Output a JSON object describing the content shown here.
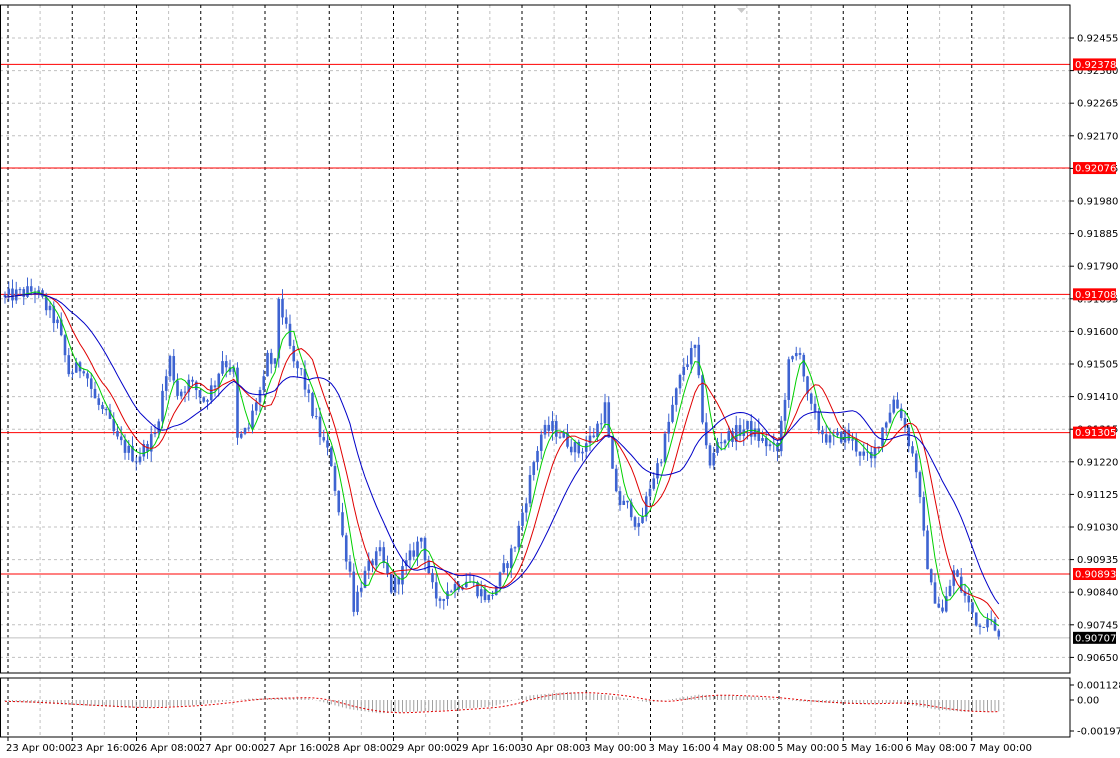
{
  "colors": {
    "background": "#ffffff",
    "grid": "#c0c0c0",
    "grid_vertical": "#000000",
    "candles": "#3d63d1",
    "level_lines": "#ff0000",
    "ma_fast": "#00d000",
    "ma_mid": "#e00000",
    "ma_slow": "#0000c8",
    "osc_histogram": "#a0a0a0",
    "osc_signal": "#e00000",
    "current_price_tag": "#000000"
  },
  "chart_data": [
    {
      "type": "candlestick",
      "title": "",
      "grid": true,
      "ylim": [
        0.9059,
        0.9252
      ],
      "y_ticks": [
        "0.92455",
        "0.92360",
        "0.92265",
        "0.92170",
        "0.92075",
        "0.91980",
        "0.91885",
        "0.91790",
        "0.91695",
        "0.91600",
        "0.91505",
        "0.91410",
        "0.91315",
        "0.91220",
        "0.91125",
        "0.91030",
        "0.90935",
        "0.90840",
        "0.90745",
        "0.90650"
      ],
      "x_tick_labels": [
        "23 Apr 00:00",
        "23 Apr 16:00",
        "26 Apr 08:00",
        "27 Apr 00:00",
        "27 Apr 16:00",
        "28 Apr 08:00",
        "29 Apr 00:00",
        "29 Apr 16:00",
        "30 Apr 08:00",
        "3 May 00:00",
        "3 May 16:00",
        "4 May 08:00",
        "5 May 00:00",
        "5 May 16:00",
        "6 May 08:00",
        "7 May 00:00"
      ],
      "levels": [
        {
          "label": "0.92378",
          "value": 0.92378
        },
        {
          "label": "0.92076",
          "value": 0.92076
        },
        {
          "label": "0.91708",
          "value": 0.91708
        },
        {
          "label": "0.91305",
          "value": 0.91305
        },
        {
          "label": "0.90893",
          "value": 0.90893
        }
      ],
      "current_price": {
        "label": "0.90707",
        "value": 0.90707
      },
      "price_path": [
        [
          0,
          0.917
        ],
        [
          8,
          0.9172
        ],
        [
          14,
          0.9162
        ],
        [
          17,
          0.9148
        ],
        [
          21,
          0.915
        ],
        [
          24,
          0.914
        ],
        [
          27,
          0.9135
        ],
        [
          30,
          0.9128
        ],
        [
          35,
          0.9123
        ],
        [
          40,
          0.913
        ],
        [
          42,
          0.9142
        ],
        [
          44,
          0.9152
        ],
        [
          46,
          0.9142
        ],
        [
          49,
          0.9145
        ],
        [
          51,
          0.9143
        ],
        [
          53,
          0.914
        ],
        [
          56,
          0.9145
        ],
        [
          58,
          0.9152
        ],
        [
          61,
          0.9148
        ],
        [
          62,
          0.9128
        ],
        [
          65,
          0.9132
        ],
        [
          67,
          0.914
        ],
        [
          69,
          0.9145
        ],
        [
          70,
          0.9152
        ],
        [
          72,
          0.915
        ],
        [
          73,
          0.917
        ],
        [
          75,
          0.916
        ],
        [
          77,
          0.915
        ],
        [
          79,
          0.9148
        ],
        [
          81,
          0.914
        ],
        [
          84,
          0.913
        ],
        [
          87,
          0.9122
        ],
        [
          90,
          0.91
        ],
        [
          92,
          0.909
        ],
        [
          93,
          0.908
        ],
        [
          95,
          0.9087
        ],
        [
          98,
          0.9093
        ],
        [
          100,
          0.9095
        ],
        [
          103,
          0.9085
        ],
        [
          107,
          0.9092
        ],
        [
          111,
          0.91
        ],
        [
          113,
          0.909
        ],
        [
          115,
          0.908
        ],
        [
          117,
          0.9084
        ],
        [
          120,
          0.9086
        ],
        [
          123,
          0.9088
        ],
        [
          126,
          0.9085
        ],
        [
          129,
          0.9082
        ],
        [
          132,
          0.9088
        ],
        [
          136,
          0.9098
        ],
        [
          139,
          0.9112
        ],
        [
          141,
          0.9122
        ],
        [
          143,
          0.913
        ],
        [
          146,
          0.9132
        ],
        [
          150,
          0.9128
        ],
        [
          153,
          0.9125
        ],
        [
          157,
          0.913
        ],
        [
          160,
          0.9138
        ],
        [
          162,
          0.9118
        ],
        [
          164,
          0.911
        ],
        [
          167,
          0.9108
        ],
        [
          169,
          0.9102
        ],
        [
          172,
          0.9115
        ],
        [
          175,
          0.9124
        ],
        [
          178,
          0.9138
        ],
        [
          181,
          0.915
        ],
        [
          184,
          0.9155
        ],
        [
          186,
          0.9135
        ],
        [
          188,
          0.912
        ],
        [
          190,
          0.9128
        ],
        [
          194,
          0.913
        ],
        [
          198,
          0.9132
        ],
        [
          202,
          0.9128
        ],
        [
          206,
          0.9125
        ],
        [
          209,
          0.915
        ],
        [
          212,
          0.9155
        ],
        [
          214,
          0.914
        ],
        [
          217,
          0.9132
        ],
        [
          220,
          0.9128
        ],
        [
          224,
          0.913
        ],
        [
          228,
          0.9125
        ],
        [
          231,
          0.9122
        ],
        [
          234,
          0.9132
        ],
        [
          237,
          0.914
        ],
        [
          239,
          0.9136
        ],
        [
          241,
          0.9128
        ],
        [
          243,
          0.912
        ],
        [
          245,
          0.91
        ],
        [
          247,
          0.9085
        ],
        [
          250,
          0.9078
        ],
        [
          253,
          0.909
        ],
        [
          255,
          0.9085
        ],
        [
          258,
          0.9078
        ],
        [
          260,
          0.9074
        ],
        [
          262,
          0.9078
        ],
        [
          264,
          0.9072
        ],
        [
          265,
          0.907
        ]
      ],
      "moving_averages": [
        {
          "role": "fast",
          "period": 5
        },
        {
          "role": "mid",
          "period": 10
        },
        {
          "role": "slow",
          "period": 20
        }
      ]
    },
    {
      "type": "bar",
      "title": "",
      "ylim": [
        -0.002,
        0.0012
      ],
      "y_ticks": [
        "0.001128",
        "0.00",
        "-0.001974"
      ],
      "histogram_path": [
        [
          0,
          -0.0001
        ],
        [
          20,
          -0.0004
        ],
        [
          35,
          -0.0006
        ],
        [
          50,
          -0.0004
        ],
        [
          65,
          0.0001
        ],
        [
          80,
          0.0002
        ],
        [
          92,
          -0.0007
        ],
        [
          100,
          -0.001
        ],
        [
          115,
          -0.0008
        ],
        [
          130,
          -0.0005
        ],
        [
          140,
          0.00035
        ],
        [
          150,
          0.0006
        ],
        [
          160,
          0.0004
        ],
        [
          172,
          -0.0002
        ],
        [
          185,
          0.0004
        ],
        [
          200,
          0.00025
        ],
        [
          212,
          -0.0001
        ],
        [
          225,
          -0.0003
        ],
        [
          238,
          -0.0002
        ],
        [
          248,
          -0.0007
        ],
        [
          256,
          -0.0009
        ],
        [
          265,
          -0.00085
        ]
      ]
    }
  ]
}
